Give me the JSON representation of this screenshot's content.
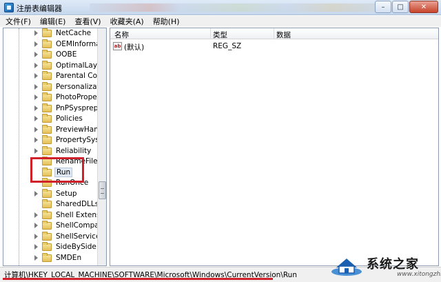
{
  "window": {
    "title": "注册表编辑器",
    "buttons": {
      "minimize": "–",
      "maximize": "□",
      "close": "✕"
    }
  },
  "menu": [
    "文件(F)",
    "编辑(E)",
    "查看(V)",
    "收藏夹(A)",
    "帮助(H)"
  ],
  "tree": {
    "items": [
      {
        "label": "NetCache"
      },
      {
        "label": "OEMInformatio"
      },
      {
        "label": "OOBE"
      },
      {
        "label": "OptimalLayout"
      },
      {
        "label": "Parental Contr"
      },
      {
        "label": "Personalization"
      },
      {
        "label": "PhotoProperty"
      },
      {
        "label": "PnPSysprep"
      },
      {
        "label": "Policies"
      },
      {
        "label": "PreviewHandle"
      },
      {
        "label": "PropertySyster"
      },
      {
        "label": "Reliability"
      },
      {
        "label": "RenameFiles"
      },
      {
        "label": "Run"
      },
      {
        "label": "RunOnce"
      },
      {
        "label": "Setup"
      },
      {
        "label": "SharedDLLs"
      },
      {
        "label": "Shell Extension"
      },
      {
        "label": "ShellCompatib"
      },
      {
        "label": "ShellServiceOb"
      },
      {
        "label": "SideBySide"
      },
      {
        "label": "SMDEn"
      }
    ],
    "selected": "Run"
  },
  "list": {
    "columns": [
      "名称",
      "类型",
      "数据"
    ],
    "rows": [
      {
        "icon": "string-value-icon",
        "icon_text": "ab",
        "name": "(默认)",
        "type": "REG_SZ",
        "data": ""
      }
    ]
  },
  "status": {
    "path": "计算机\\HKEY_LOCAL_MACHINE\\SOFTWARE\\Microsoft\\Windows\\CurrentVersion\\Run"
  },
  "watermark": {
    "text": "系统之家",
    "sub": "www.xitongzhijia.net"
  },
  "colors": {
    "annotation_red": "#d0202a",
    "folder_yellow": "#e4c058",
    "titlebar": "#c6d8ee"
  }
}
